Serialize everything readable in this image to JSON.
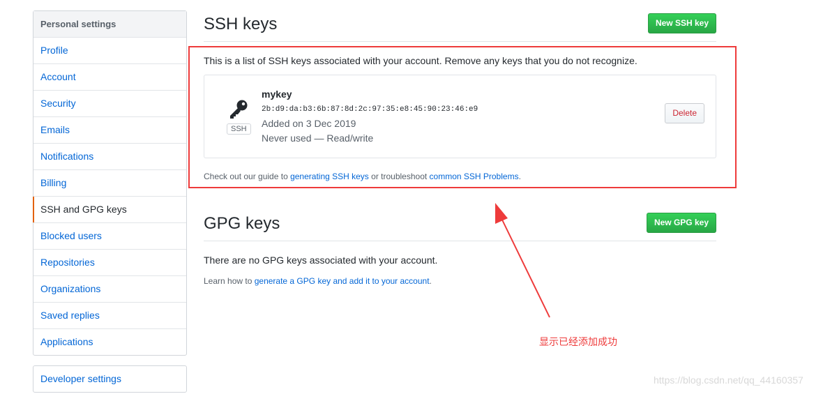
{
  "sidebar": {
    "heading": "Personal settings",
    "items": [
      {
        "label": "Profile"
      },
      {
        "label": "Account"
      },
      {
        "label": "Security"
      },
      {
        "label": "Emails"
      },
      {
        "label": "Notifications"
      },
      {
        "label": "Billing"
      },
      {
        "label": "SSH and GPG keys",
        "selected": true
      },
      {
        "label": "Blocked users"
      },
      {
        "label": "Repositories"
      },
      {
        "label": "Organizations"
      },
      {
        "label": "Saved replies"
      },
      {
        "label": "Applications"
      }
    ],
    "developer_settings": "Developer settings"
  },
  "ssh": {
    "title": "SSH keys",
    "new_button": "New SSH key",
    "intro": "This is a list of SSH keys associated with your account. Remove any keys that you do not recognize.",
    "key": {
      "icon": "key-icon",
      "badge": "SSH",
      "name": "mykey",
      "fingerprint": "2b:d9:da:b3:6b:87:8d:2c:97:35:e8:45:90:23:46:e9",
      "added": "Added on 3 Dec 2019",
      "usage": "Never used — Read/write",
      "delete_label": "Delete"
    },
    "help_prefix": "Check out our guide to ",
    "help_link1": "generating SSH keys",
    "help_mid": " or troubleshoot ",
    "help_link2": "common SSH Problems",
    "help_suffix": "."
  },
  "gpg": {
    "title": "GPG keys",
    "new_button": "New GPG key",
    "empty": "There are no GPG keys associated with your account.",
    "help_prefix": "Learn how to ",
    "help_link": "generate a GPG key and add it to your account",
    "help_suffix": "."
  },
  "annotation": {
    "text": "显示已经添加成功",
    "color": "#ee3b3b"
  },
  "watermark": "https://blog.csdn.net/qq_44160357"
}
